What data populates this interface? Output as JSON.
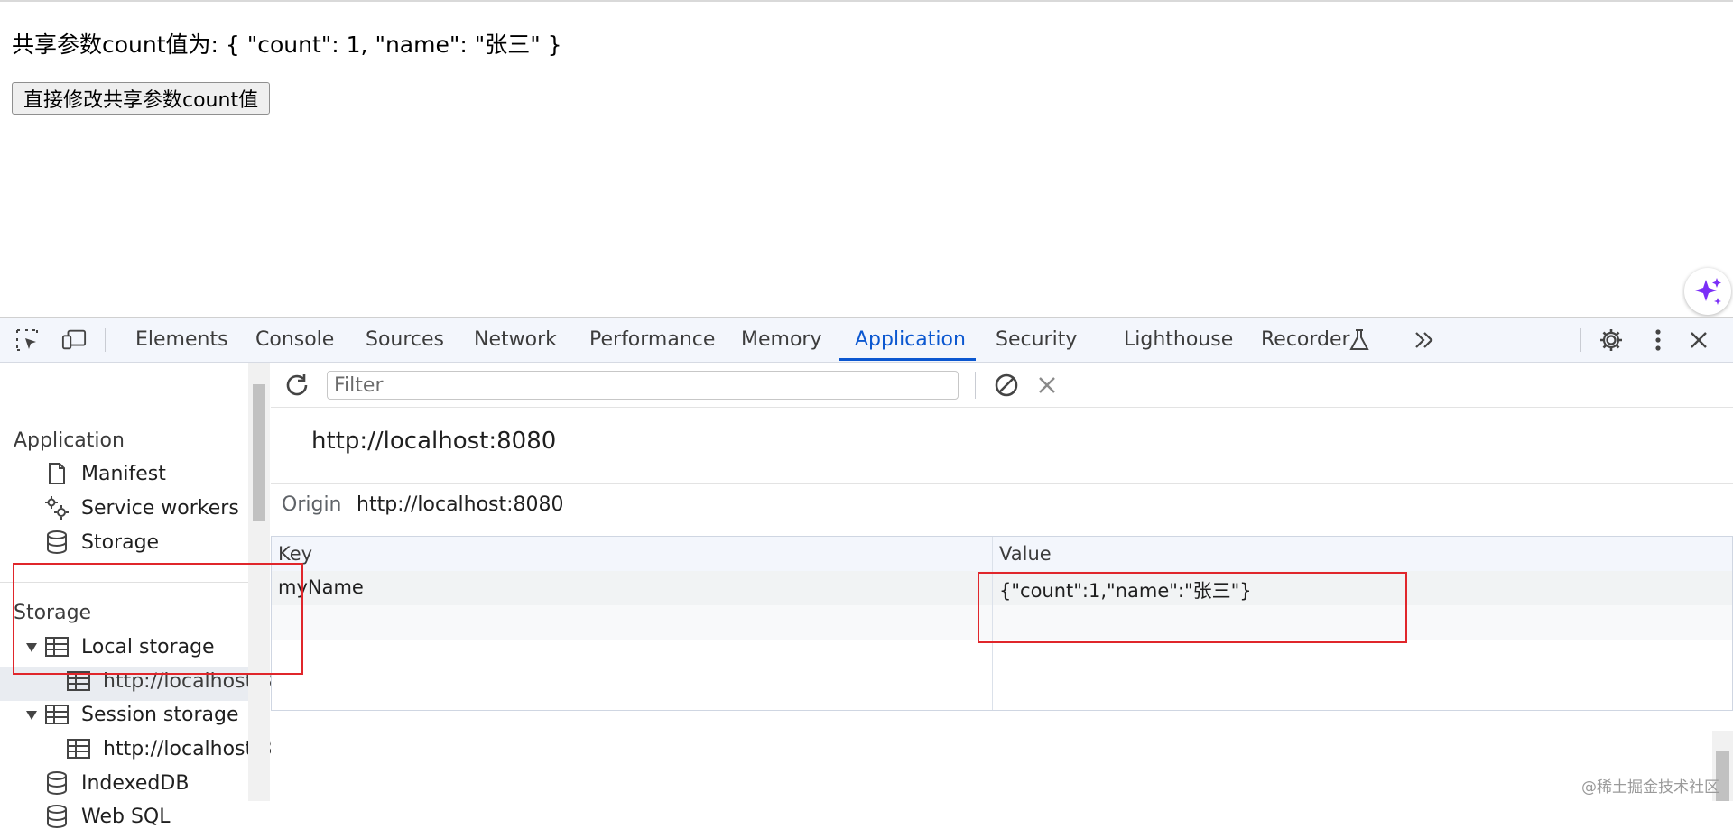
{
  "page": {
    "shared_text": "共享参数count值为: { \"count\": 1, \"name\": \"张三\" }",
    "modify_button": "直接修改共享参数count值"
  },
  "devtools": {
    "tabs": [
      "Elements",
      "Console",
      "Sources",
      "Network",
      "Performance",
      "Memory",
      "Application",
      "Security",
      "Lighthouse",
      "Recorder"
    ],
    "active_tab": "Application",
    "sidebar": {
      "application_heading": "Application",
      "application_items": [
        "Manifest",
        "Service workers",
        "Storage"
      ],
      "storage_heading": "Storage",
      "local_storage": "Local storage",
      "local_storage_origin": "http://localhost:8",
      "session_storage": "Session storage",
      "session_storage_origin": "http://localhost:8",
      "indexeddb": "IndexedDB",
      "websql": "Web SQL"
    },
    "toolbar": {
      "filter_placeholder": "Filter"
    },
    "storage_view": {
      "title": "http://localhost:8080",
      "origin_label": "Origin",
      "origin_value": "http://localhost:8080",
      "columns": [
        "Key",
        "Value"
      ],
      "rows": [
        {
          "key": "myName",
          "value": "{\"count\":1,\"name\":\"张三\"}"
        }
      ]
    }
  },
  "watermark": "@稀土掘金技术社区",
  "colors": {
    "accent": "#0b57d0",
    "highlight_box": "#e0262b",
    "ai_sparkle": "#7b2ff7"
  }
}
